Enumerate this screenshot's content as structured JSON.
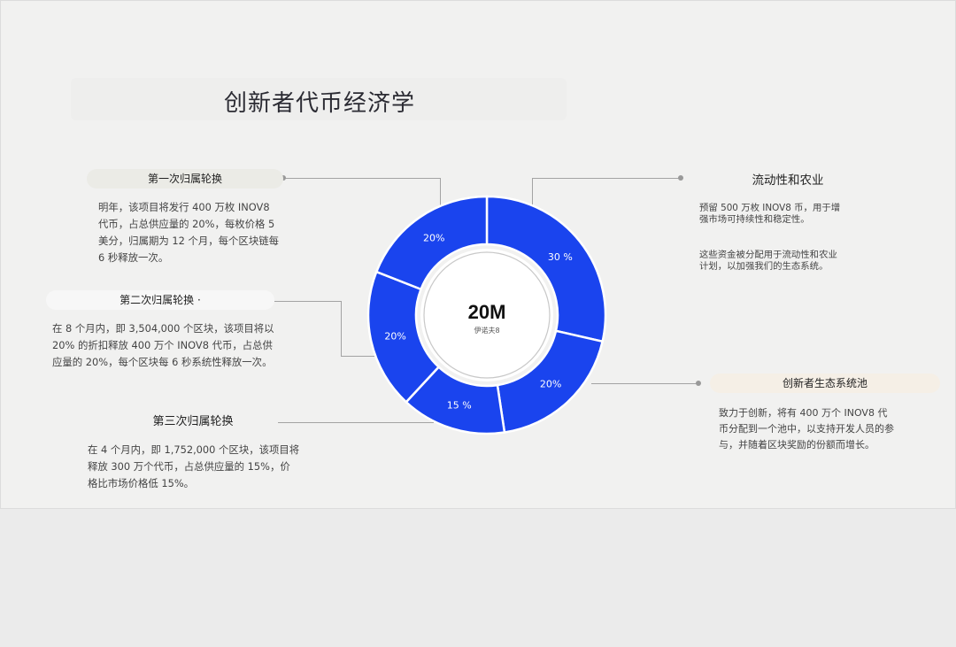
{
  "page": {
    "title": "创新者代币经济学"
  },
  "annotations": {
    "first_vesting": {
      "heading": "第一次归属轮换",
      "text": "明年，该项目将发行 400 万枚 INOV8 代币，占总供应量的 20%，每枚价格 5 美分，归属期为 12 个月，每个区块链每 6 秒释放一次。"
    },
    "second_vesting": {
      "heading": "第二次归属轮换 ·",
      "text": "在 8 个月内，即 3,504,000 个区块，该项目将以 20% 的折扣释放 400 万个 INOV8 代币，占总供应量的 20%，每个区块每 6 秒系统性释放一次。"
    },
    "third_vesting": {
      "heading": "第三次归属轮换",
      "text": "在 4 个月内，即 1,752,000 个区块，该项目将释放 300 万个代币，占总供应量的 15%，价格比市场价格低 15%。"
    },
    "liquidity": {
      "heading": "流动性和农业",
      "text1": "预留 500 万枚 INOV8 币，用于增强市场可持续性和稳定性。",
      "text2": "这些资金被分配用于流动性和农业计划，以加强我们的生态系统。"
    },
    "ecosystem": {
      "heading": "创新者生态系统池",
      "text": "致力于创新，将有 400 万个 INOV8 代币分配到一个池中，以支持开发人员的参与，并随着区块奖励的份额而增长。"
    }
  },
  "chart_data": {
    "type": "pie",
    "variant": "donut",
    "center_value": "20M",
    "center_label": "伊诺夫8",
    "slices": [
      {
        "label": "30 %",
        "value": 30
      },
      {
        "label": "20%",
        "value": 20
      },
      {
        "label": "15 %",
        "value": 15
      },
      {
        "label": "20%",
        "value": 20
      },
      {
        "label": "20%",
        "value": 20
      }
    ],
    "colors": {
      "slice": "#1a44ee",
      "separator": "#ffffff",
      "label": "#ffffff"
    }
  }
}
